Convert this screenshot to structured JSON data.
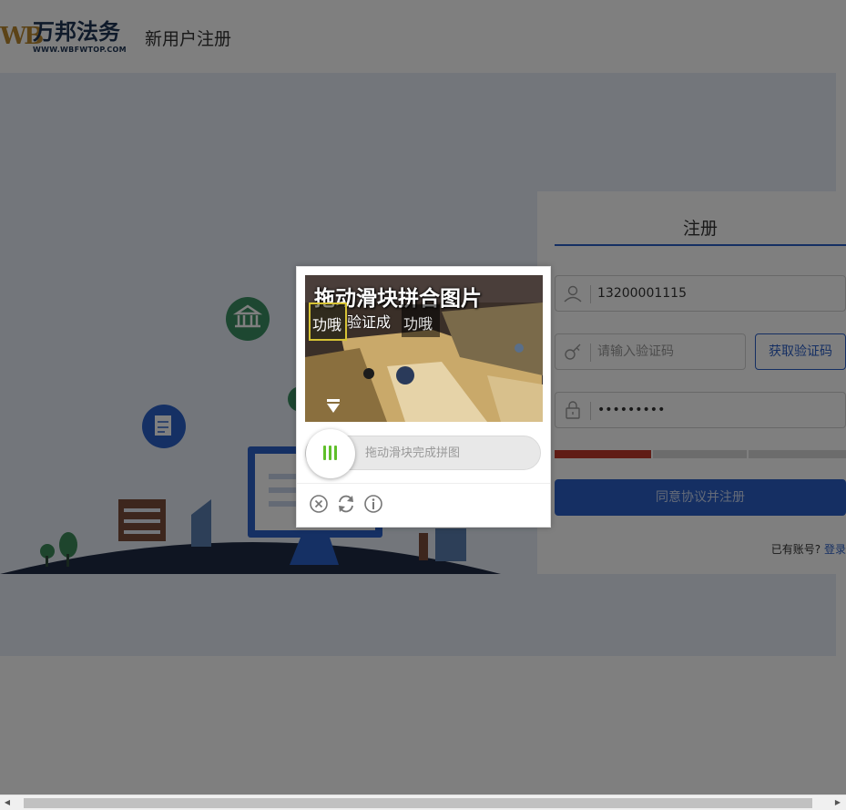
{
  "header": {
    "logo_mark": "WB",
    "logo_text": "万邦法务",
    "logo_url": "WWW.WBFWTOP.COM",
    "title": "新用户注册"
  },
  "register": {
    "title": "注册",
    "phone_value": "13200001115",
    "code_placeholder": "请输入验证码",
    "get_code_label": "获取验证码",
    "password_value": "•••••••••",
    "strength_level": "weak",
    "strength_segments": [
      "weak",
      "medium",
      "strong"
    ],
    "submit_label": "同意协议并注册",
    "have_account_text": "已有账号?",
    "login_link": "登录"
  },
  "captcha": {
    "image_title": "拖动滑块拼合图片",
    "image_subtitle": "验证成",
    "piece_text": "功哦",
    "hole_text": "功哦",
    "slider_hint": "拖动滑块完成拼图",
    "tools": [
      "close-icon",
      "refresh-icon",
      "info-icon"
    ]
  },
  "colors": {
    "accent": "#2b5fc7",
    "strength_weak": "#c0392b",
    "slider_grip": "#5fbf2a",
    "overlay": "rgba(0,0,0,0.5)"
  }
}
